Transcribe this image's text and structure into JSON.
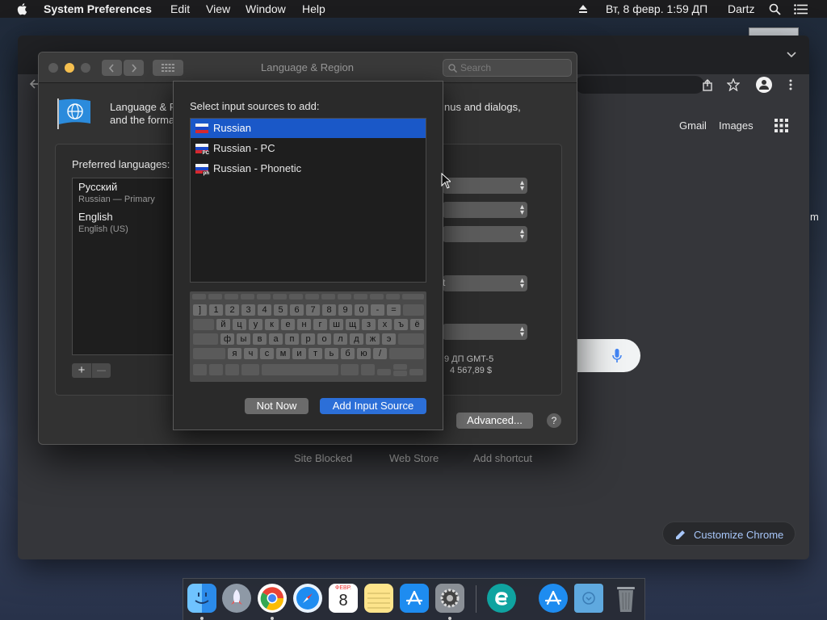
{
  "menubar": {
    "app": "System Preferences",
    "items": [
      "Edit",
      "View",
      "Window",
      "Help"
    ],
    "datetime": "Вт, 8 февр.  1:59 ДП",
    "user": "Dartz"
  },
  "chrome": {
    "links": [
      "Gmail",
      "Images"
    ],
    "shortcuts": [
      "Site Blocked",
      "Web Store",
      "Add shortcut"
    ],
    "customize": "Customize Chrome",
    "edge_text": "m"
  },
  "syspref": {
    "title": "Language & Region",
    "search_placeholder": "Search",
    "header_line1": "Language & R",
    "header_line2": "and the forma",
    "header_right": "nus and dialogs,",
    "preferred_label": "Preferred languages:",
    "languages": [
      {
        "name": "Русский",
        "sub": "Russian — Primary"
      },
      {
        "name": "English",
        "sub": "English (US)"
      }
    ],
    "popup_partial": "t",
    "time_sample": "9 ДП GMT-5",
    "number_sample": "4 567,89 $",
    "advanced": "Advanced...",
    "help": "?",
    "add": "+",
    "remove": "—"
  },
  "sheet": {
    "heading": "Select input sources to add:",
    "sources": [
      {
        "label": "Russian",
        "badge": ""
      },
      {
        "label": "Russian - PC",
        "badge": "PC"
      },
      {
        "label": "Russian - Phonetic",
        "badge": "ph"
      }
    ],
    "keys": {
      "row1": [
        "]",
        "1",
        "2",
        "3",
        "4",
        "5",
        "6",
        "7",
        "8",
        "9",
        "0",
        "-",
        "="
      ],
      "row2": [
        "й",
        "ц",
        "у",
        "к",
        "е",
        "н",
        "г",
        "ш",
        "щ",
        "з",
        "х",
        "ъ",
        "ё"
      ],
      "row3": [
        "ф",
        "ы",
        "в",
        "а",
        "п",
        "р",
        "о",
        "л",
        "д",
        "ж",
        "э"
      ],
      "row4": [
        "я",
        "ч",
        "с",
        "м",
        "и",
        "т",
        "ь",
        "б",
        "ю",
        "/"
      ]
    },
    "cancel": "Not Now",
    "confirm": "Add Input Source"
  },
  "dock": {
    "calendar_month": "ФЕВР.",
    "calendar_day": "8"
  }
}
